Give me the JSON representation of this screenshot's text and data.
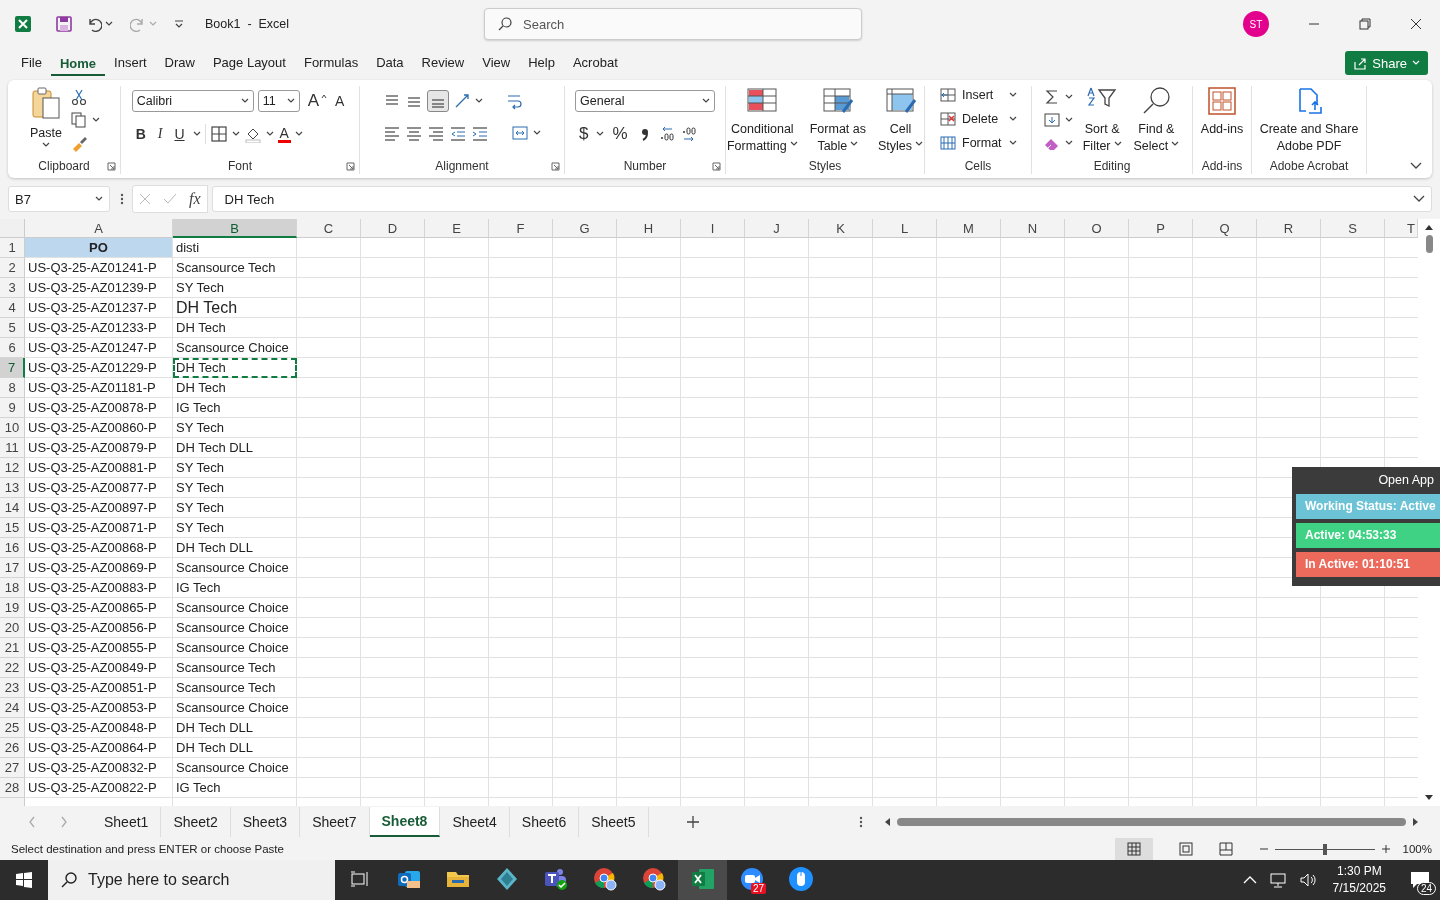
{
  "title_bar": {
    "title": "Book1  -  Excel",
    "search_placeholder": "Search",
    "avatar": "ST"
  },
  "menu_tabs": [
    {
      "label": "File",
      "selected": false
    },
    {
      "label": "Home",
      "selected": true
    },
    {
      "label": "Insert",
      "selected": false
    },
    {
      "label": "Draw",
      "selected": false
    },
    {
      "label": "Page Layout",
      "selected": false
    },
    {
      "label": "Formulas",
      "selected": false
    },
    {
      "label": "Data",
      "selected": false
    },
    {
      "label": "Review",
      "selected": false
    },
    {
      "label": "View",
      "selected": false
    },
    {
      "label": "Help",
      "selected": false
    },
    {
      "label": "Acrobat",
      "selected": false
    }
  ],
  "share_button": "Share",
  "ribbon": {
    "clipboard": {
      "label": "Clipboard",
      "paste": "Paste"
    },
    "font": {
      "label": "Font",
      "font_name": "Calibri",
      "font_size": "11",
      "grow": "A",
      "shrink": "A",
      "bold": "B",
      "italic": "I",
      "underline": "U",
      "color_button": "A"
    },
    "alignment": {
      "label": "Alignment"
    },
    "number": {
      "label": "Number",
      "format": "General",
      "currency": "$",
      "percent": "%"
    },
    "styles": {
      "label": "Styles",
      "buttons": [
        {
          "lines": [
            "Conditional",
            "Formatting"
          ]
        },
        {
          "lines": [
            "Format as",
            "Table"
          ]
        },
        {
          "lines": [
            "Cell",
            "Styles"
          ]
        }
      ]
    },
    "cells": {
      "label": "Cells",
      "buttons": [
        "Insert",
        "Delete",
        "Format"
      ]
    },
    "editing": {
      "label": "Editing",
      "buttons": [
        {
          "lines": [
            "Sort &",
            "Filter"
          ]
        },
        {
          "lines": [
            "Find &",
            "Select"
          ]
        }
      ]
    },
    "addins": {
      "label": "Add-ins",
      "button": "Add-ins"
    },
    "acrobat": {
      "label": "Adobe Acrobat",
      "lines": [
        "Create and Share",
        "Adobe PDF"
      ]
    }
  },
  "formula_bar": {
    "name_box": "B7",
    "fx": "fx",
    "value": "DH Tech"
  },
  "columns": [
    {
      "label": "A",
      "selected": false
    },
    {
      "label": "B",
      "selected": true
    },
    {
      "label": "C",
      "selected": false
    },
    {
      "label": "D",
      "selected": false
    },
    {
      "label": "E",
      "selected": false
    },
    {
      "label": "F",
      "selected": false
    },
    {
      "label": "G",
      "selected": false
    },
    {
      "label": "H",
      "selected": false
    },
    {
      "label": "I",
      "selected": false
    },
    {
      "label": "J",
      "selected": false
    },
    {
      "label": "K",
      "selected": false
    },
    {
      "label": "L",
      "selected": false
    },
    {
      "label": "M",
      "selected": false
    },
    {
      "label": "N",
      "selected": false
    },
    {
      "label": "O",
      "selected": false
    },
    {
      "label": "P",
      "selected": false
    },
    {
      "label": "Q",
      "selected": false
    },
    {
      "label": "R",
      "selected": false
    },
    {
      "label": "S",
      "selected": false
    },
    {
      "label": "T",
      "selected": false
    }
  ],
  "header_row": {
    "n": "1",
    "a": "PO",
    "b": "disti"
  },
  "rows": [
    {
      "n": "2",
      "a": "US-Q3-25-AZ01241-P",
      "b": "Scansource Tech",
      "selected": false,
      "large": false
    },
    {
      "n": "3",
      "a": "US-Q3-25-AZ01239-P",
      "b": "SY Tech",
      "selected": false,
      "large": false
    },
    {
      "n": "4",
      "a": "US-Q3-25-AZ01237-P",
      "b": "DH Tech",
      "selected": false,
      "large": true
    },
    {
      "n": "5",
      "a": "US-Q3-25-AZ01233-P",
      "b": "DH Tech",
      "selected": false,
      "large": false
    },
    {
      "n": "6",
      "a": "US-Q3-25-AZ01247-P",
      "b": "Scansource Choice",
      "selected": false,
      "large": false
    },
    {
      "n": "7",
      "a": "US-Q3-25-AZ01229-P",
      "b": "DH Tech",
      "selected": true,
      "large": false
    },
    {
      "n": "8",
      "a": "US-Q3-25-AZ01181-P",
      "b": "DH Tech",
      "selected": false,
      "large": false
    },
    {
      "n": "9",
      "a": "US-Q3-25-AZ00878-P",
      "b": "IG Tech",
      "selected": false,
      "large": false
    },
    {
      "n": "10",
      "a": "US-Q3-25-AZ00860-P",
      "b": "SY Tech",
      "selected": false,
      "large": false
    },
    {
      "n": "11",
      "a": "US-Q3-25-AZ00879-P",
      "b": "DH Tech DLL",
      "selected": false,
      "large": false
    },
    {
      "n": "12",
      "a": "US-Q3-25-AZ00881-P",
      "b": "SY Tech",
      "selected": false,
      "large": false
    },
    {
      "n": "13",
      "a": "US-Q3-25-AZ00877-P",
      "b": "SY Tech",
      "selected": false,
      "large": false
    },
    {
      "n": "14",
      "a": "US-Q3-25-AZ00897-P",
      "b": "SY Tech",
      "selected": false,
      "large": false
    },
    {
      "n": "15",
      "a": "US-Q3-25-AZ00871-P",
      "b": "SY Tech",
      "selected": false,
      "large": false
    },
    {
      "n": "16",
      "a": "US-Q3-25-AZ00868-P",
      "b": "DH Tech DLL",
      "selected": false,
      "large": false
    },
    {
      "n": "17",
      "a": "US-Q3-25-AZ00869-P",
      "b": "Scansource Choice",
      "selected": false,
      "large": false
    },
    {
      "n": "18",
      "a": "US-Q3-25-AZ00883-P",
      "b": "IG Tech",
      "selected": false,
      "large": false
    },
    {
      "n": "19",
      "a": "US-Q3-25-AZ00865-P",
      "b": "Scansource Choice",
      "selected": false,
      "large": false
    },
    {
      "n": "20",
      "a": "US-Q3-25-AZ00856-P",
      "b": "Scansource Choice",
      "selected": false,
      "large": false
    },
    {
      "n": "21",
      "a": "US-Q3-25-AZ00855-P",
      "b": "Scansource Choice",
      "selected": false,
      "large": false
    },
    {
      "n": "22",
      "a": "US-Q3-25-AZ00849-P",
      "b": "Scansource Tech",
      "selected": false,
      "large": false
    },
    {
      "n": "23",
      "a": "US-Q3-25-AZ00851-P",
      "b": "Scansource Tech",
      "selected": false,
      "large": false
    },
    {
      "n": "24",
      "a": "US-Q3-25-AZ00853-P",
      "b": "Scansource Choice",
      "selected": false,
      "large": false
    },
    {
      "n": "25",
      "a": "US-Q3-25-AZ00848-P",
      "b": "DH Tech DLL",
      "selected": false,
      "large": false
    },
    {
      "n": "26",
      "a": "US-Q3-25-AZ00864-P",
      "b": "DH Tech DLL",
      "selected": false,
      "large": false
    },
    {
      "n": "27",
      "a": "US-Q3-25-AZ00832-P",
      "b": "Scansource Choice",
      "selected": false,
      "large": false
    },
    {
      "n": "28",
      "a": "US-Q3-25-AZ00822-P",
      "b": "IG Tech",
      "selected": false,
      "large": false
    }
  ],
  "sheet_tabs": [
    {
      "label": "Sheet1",
      "selected": false
    },
    {
      "label": "Sheet2",
      "selected": false
    },
    {
      "label": "Sheet3",
      "selected": false
    },
    {
      "label": "Sheet7",
      "selected": false
    },
    {
      "label": "Sheet8",
      "selected": true
    },
    {
      "label": "Sheet4",
      "selected": false
    },
    {
      "label": "Sheet6",
      "selected": false
    },
    {
      "label": "Sheet5",
      "selected": false
    }
  ],
  "status_bar": {
    "message": "Select destination and press ENTER or choose Paste",
    "zoom": {
      "level": 0.5,
      "label": "100%"
    }
  },
  "widget": {
    "open_app": "Open App",
    "items": [
      {
        "text": "Working Status: Active",
        "color": "#6cc3d5"
      },
      {
        "text": "Active: 04:53:33",
        "color": "#3fd184"
      },
      {
        "text": "In Active: 01:10:51",
        "color": "#ec6a5c"
      }
    ]
  },
  "taskbar": {
    "search_placeholder": "Type here to search",
    "video_badge": "27",
    "time": "1:30 PM",
    "date": "7/15/2025",
    "notifications": "24"
  }
}
